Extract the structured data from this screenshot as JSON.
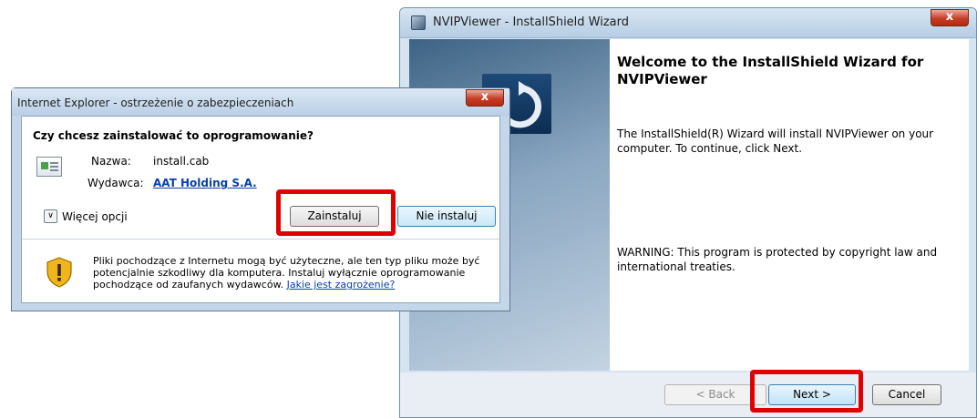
{
  "installer": {
    "title": "NVIPViewer - InstallShield Wizard",
    "close_label": "x",
    "welcome_heading": "Welcome to the InstallShield Wizard for NVIPViewer",
    "intro_text": "The InstallShield(R) Wizard will install NVIPViewer on your computer. To continue, click Next.",
    "warning_text": "WARNING: This program is protected by copyright law and international treaties.",
    "buttons": {
      "back": "< Back",
      "next": "Next >",
      "cancel": "Cancel"
    }
  },
  "ie_dialog": {
    "title": "Internet Explorer - ostrzeżenie o zabezpieczeniach",
    "close_label": "x",
    "question": "Czy chcesz zainstalować to oprogramowanie?",
    "name_label": "Nazwa:",
    "name_value": "install.cab",
    "publisher_label": "Wydawca:",
    "publisher_value": "AAT Holding S.A.",
    "more_options_label": "Więcej opcji",
    "buttons": {
      "install": "Zainstaluj",
      "dont_install": "Nie instaluj"
    },
    "warning_text": "Pliki pochodzące z Internetu mogą być użyteczne, ale ten typ pliku może być potencjalnie szkodliwy dla komputera. Instaluj wyłącznie oprogramowanie pochodzące od zaufanych wydawców.",
    "warning_link": "Jakie jest zagrożenie?"
  },
  "icons": {
    "installer_app": "installer-icon",
    "file": "file-icon",
    "shield": "security-shield-icon",
    "expand": "chevron-down-icon"
  },
  "colors": {
    "highlight": "#e00000",
    "link": "#0a3fa8",
    "close_button": "#c63d26"
  }
}
